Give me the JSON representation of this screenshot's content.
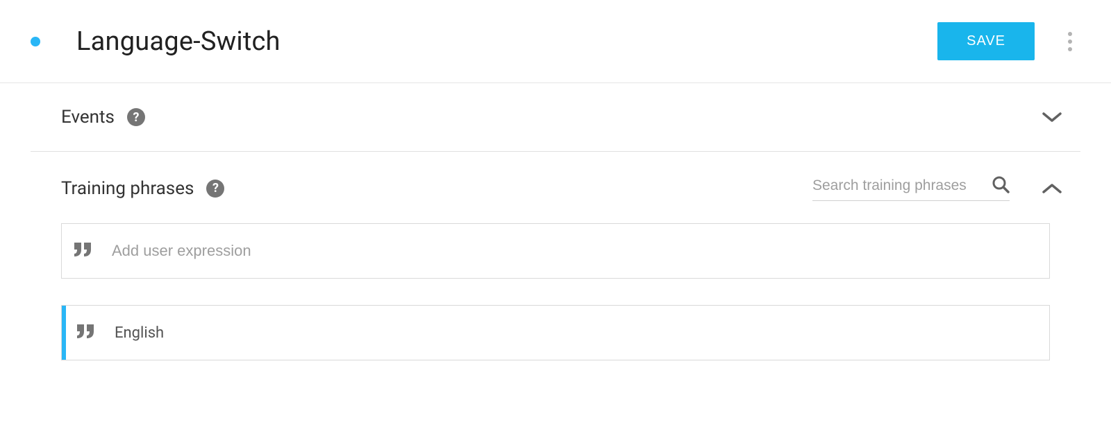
{
  "header": {
    "title": "Language-Switch",
    "save_label": "SAVE"
  },
  "sections": {
    "events": {
      "title": "Events"
    },
    "training": {
      "title": "Training phrases",
      "search_placeholder": "Search training phrases",
      "add_placeholder": "Add user expression",
      "phrases": [
        "English"
      ]
    }
  }
}
